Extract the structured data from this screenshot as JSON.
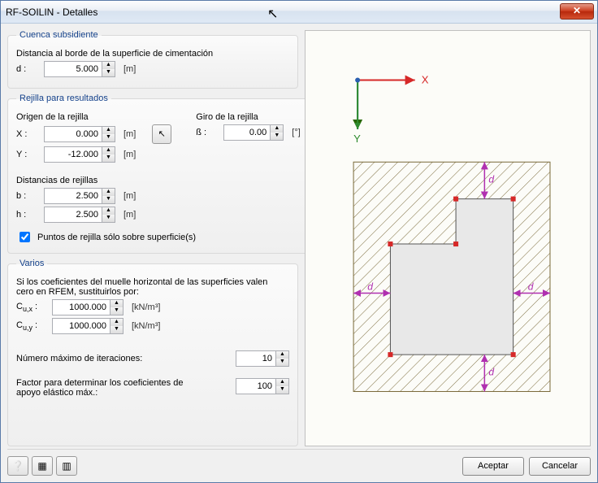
{
  "window": {
    "title": "RF-SOILIN - Detalles"
  },
  "cuenca": {
    "legend": "Cuenca subsidiente",
    "label_dist": "Distancia al borde de la superficie de cimentación",
    "d_label": "d :",
    "d_value": "5.000",
    "d_unit": "[m]"
  },
  "rejilla": {
    "legend": "Rejilla para resultados",
    "origen_label": "Origen de la rejilla",
    "giro_label": "Giro de la rejilla",
    "x_label": "X :",
    "x_value": "0.000",
    "x_unit": "[m]",
    "y_label": "Y :",
    "y_value": "-12.000",
    "y_unit": "[m]",
    "b_label_sym": "ß :",
    "b_value": "0.00",
    "b_unit": "[°]",
    "dist_label": "Distancias de rejillas",
    "bb_label": "b :",
    "bb_value": "2.500",
    "bb_unit": "[m]",
    "hh_label": "h :",
    "hh_value": "2.500",
    "hh_unit": "[m]",
    "checkbox_label": "Puntos de rejilla sólo sobre superficie(s)"
  },
  "varios": {
    "legend": "Varios",
    "intro": "Si los coeficientes del muelle horizontal de las superficies valen cero en RFEM, sustituirlos por:",
    "cux_label": "Cu,x :",
    "cux_value": "1000.000",
    "cux_unit": "[kN/m³]",
    "cuy_label": "Cu,y :",
    "cuy_value": "1000.000",
    "cuy_unit": "[kN/m³]",
    "iter_label": "Número máximo de iteraciones:",
    "iter_value": "10",
    "factor_label": "Factor para determinar los coeficientes de apoyo elástico máx.:",
    "factor_value": "100"
  },
  "buttons": {
    "accept": "Aceptar",
    "cancel": "Cancelar"
  },
  "diagram": {
    "axis_x": "X",
    "axis_y": "Y",
    "dim_d": "d"
  }
}
